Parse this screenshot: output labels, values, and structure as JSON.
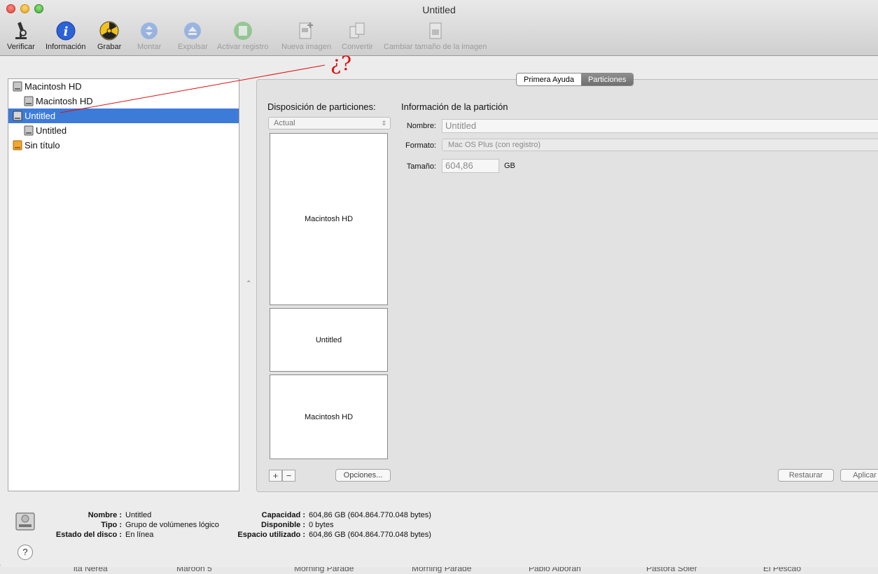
{
  "window": {
    "title": "Untitled"
  },
  "toolbar": {
    "verify": "Verificar",
    "info": "Información",
    "burn": "Grabar",
    "mount": "Montar",
    "eject": "Expulsar",
    "enable_journal": "Activar registro",
    "new_image": "Nueva imagen",
    "convert": "Convertir",
    "resize_image": "Cambiar tamaño de la imagen"
  },
  "annotation": {
    "mark": "¿?",
    "color": "#dd1111"
  },
  "sidebar": {
    "items": [
      {
        "label": "Macintosh HD",
        "level": 0,
        "icon": "internal-disk-icon"
      },
      {
        "label": "Macintosh HD",
        "level": 1,
        "icon": "volume-icon"
      },
      {
        "label": "Untitled",
        "level": 0,
        "icon": "internal-disk-icon",
        "selected": true
      },
      {
        "label": "Untitled",
        "level": 1,
        "icon": "volume-icon"
      },
      {
        "label": "Sin título",
        "level": 0,
        "icon": "external-disk-icon"
      }
    ]
  },
  "tabs": {
    "first_aid": "Primera Ayuda",
    "partitions": "Particiones",
    "active": "partitions"
  },
  "layout": {
    "title": "Disposición de particiones:",
    "select_value": "Actual",
    "partitions": [
      "Macintosh HD",
      "Untitled",
      "Macintosh HD"
    ],
    "add": "+",
    "remove": "−",
    "options": "Opciones..."
  },
  "partition_info": {
    "title": "Información de la partición",
    "name_label": "Nombre:",
    "name_value": "Untitled",
    "format_label": "Formato:",
    "format_value": "Mac OS Plus (con registro)",
    "size_label": "Tamaño:",
    "size_value": "604,86",
    "size_unit": "GB",
    "restore": "Restaurar",
    "apply": "Aplicar"
  },
  "details": {
    "name_label": "Nombre :",
    "name_value": "Untitled",
    "type_label": "Tipo :",
    "type_value": "Grupo de volúmenes lógico",
    "status_label": "Estado del disco :",
    "status_value": "En línea",
    "capacity_label": "Capacidad :",
    "capacity_value": "604,86 GB (604.864.770.048 bytes)",
    "available_label": "Disponible :",
    "available_value": "0 bytes",
    "used_label": "Espacio utilizado :",
    "used_value": "604,86 GB (604.864.770.048 bytes)",
    "help": "?"
  },
  "background_strip": [
    "ita Nerea",
    "Maroon 5",
    "Morning Parade",
    "Morning Parade",
    "Pablo Alborán",
    "Pastora Soler",
    "El Pescao"
  ],
  "colors": {
    "selection": "#3d7bd9",
    "panel": "#e2e2e2"
  }
}
